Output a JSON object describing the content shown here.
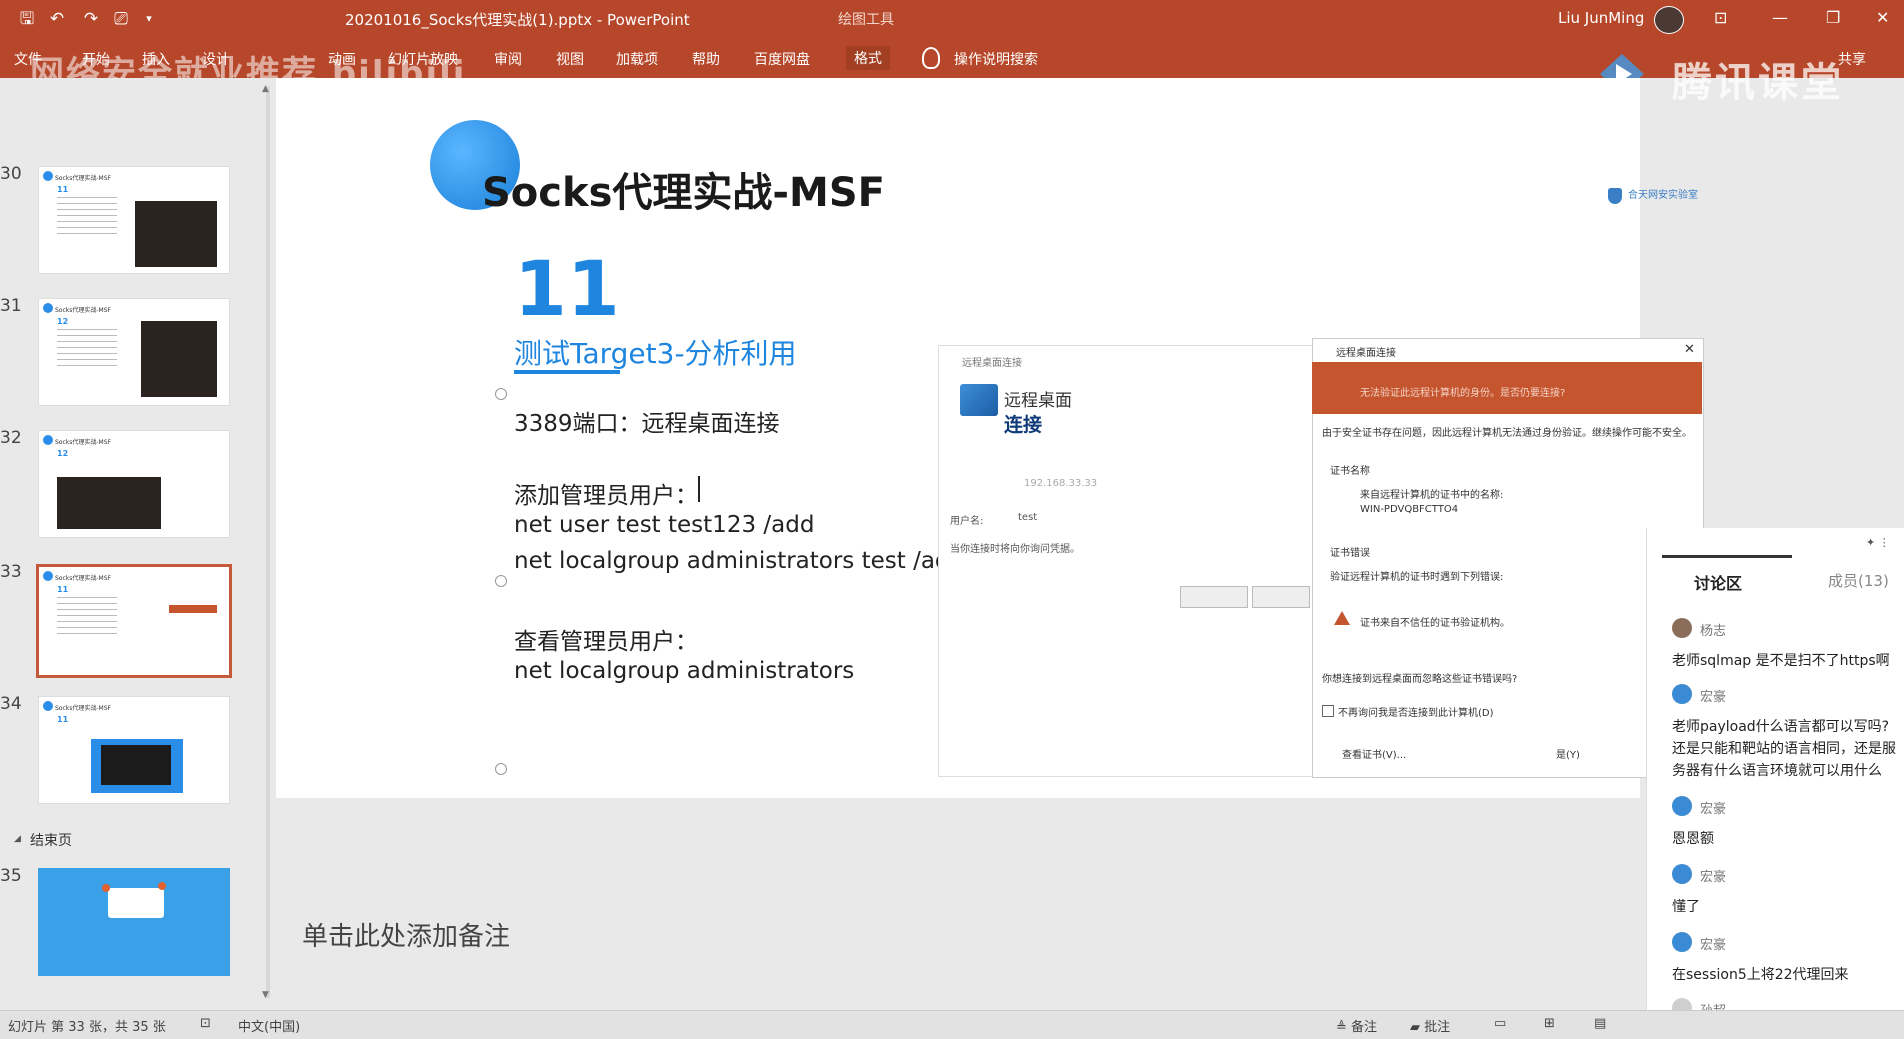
{
  "window": {
    "doc_title": "20201016_Socks代理实战(1).pptx  -  PowerPoint",
    "context_tools": "绘图工具",
    "user_name": "Liu JunMing",
    "share": "共享"
  },
  "ribbon_tabs": [
    "文件",
    "开始",
    "插入",
    "设计",
    "动画",
    "幻灯片放映",
    "审阅",
    "视图",
    "加载项",
    "帮助",
    "百度网盘",
    "格式"
  ],
  "tell_me": "操作说明搜索",
  "watermarks": {
    "left": "网络安全就业推荐 bilibili",
    "right": "腾讯课堂"
  },
  "thumbnails": {
    "items": [
      {
        "num": "30",
        "title": "Socks代理实战-MSF",
        "sub": "11"
      },
      {
        "num": "31",
        "title": "Socks代理实战-MSF",
        "sub": "12"
      },
      {
        "num": "32",
        "title": "Socks代理实战-MSF",
        "sub": "12"
      },
      {
        "num": "33",
        "title": "Socks代理实战-MSF",
        "sub": "11"
      },
      {
        "num": "34",
        "title": "Socks代理实战-MSF",
        "sub": "11"
      },
      {
        "num": "35",
        "title": "",
        "sub": ""
      }
    ],
    "section_label": "结束页",
    "selected": "33"
  },
  "slide": {
    "title": "Socks代理实战-MSF",
    "logo_text": "合天网安实验室",
    "big_number": "11",
    "subtitle": "测试Target3-分析利用",
    "lines": [
      "3389端口：远程桌面连接",
      "添加管理员用户：",
      "net user test test123 /add",
      "net localgroup administrators test /ad",
      "查看管理员用户：",
      "net localgroup administrators"
    ],
    "rdp": {
      "window_title": "远程桌面连接",
      "app_name_line1": "远程桌面",
      "app_name_line2": "连接",
      "ip": "192.168.33.33",
      "user_label": "用户名:",
      "user_value": "test",
      "creds_note": "当你连接时将向你询问凭据。",
      "cert_title": "远程桌面连接",
      "cert_head": "无法验证此远程计算机的身份。是否仍要连接?",
      "cert_desc": "由于安全证书存在问题，因此远程计算机无法通过身份验证。继续操作可能不安全。",
      "cert_name_label": "证书名称",
      "cert_name_desc": "来自远程计算机的证书中的名称:",
      "cert_name_value": "WIN-PDVQBFCTTO4",
      "cert_err_label": "证书错误",
      "cert_err_desc": "验证远程计算机的证书时遇到下列错误:",
      "cert_err_item": "证书来自不信任的证书验证机构。",
      "cert_question": "你想连接到远程桌面而忽略这些证书错误吗?",
      "cert_checkbox": "不再询问我是否连接到此计算机(D)",
      "view_cert_btn": "查看证书(V)...",
      "yes_btn": "是(Y)"
    }
  },
  "notes_placeholder": "单击此处添加备注",
  "discussion": {
    "title": "讨论区",
    "members": "成员(13)",
    "messages": [
      {
        "name": "杨志",
        "text": "老师sqlmap 是不是扫不了https啊",
        "avatar": "brown"
      },
      {
        "name": "宏豪",
        "text": "老师payload什么语言都可以写吗?",
        "avatar": "blue"
      },
      {
        "name": "",
        "text": "还是只能和靶站的语言相同，还是服",
        "avatar": ""
      },
      {
        "name": "",
        "text": "务器有什么语言环境就可以用什么",
        "avatar": ""
      },
      {
        "name": "宏豪",
        "text": "恩恩额",
        "avatar": "blue"
      },
      {
        "name": "宏豪",
        "text": "懂了",
        "avatar": "blue"
      },
      {
        "name": "宏豪",
        "text": "在session5上将22代理回来",
        "avatar": "blue"
      },
      {
        "name": "孙超",
        "text": "",
        "avatar": "blue"
      }
    ]
  },
  "statusbar": {
    "slide_info": "幻灯片 第 33 张，共 35 张",
    "language": "中文(中国)",
    "notes": "备注",
    "comments": "批注"
  }
}
